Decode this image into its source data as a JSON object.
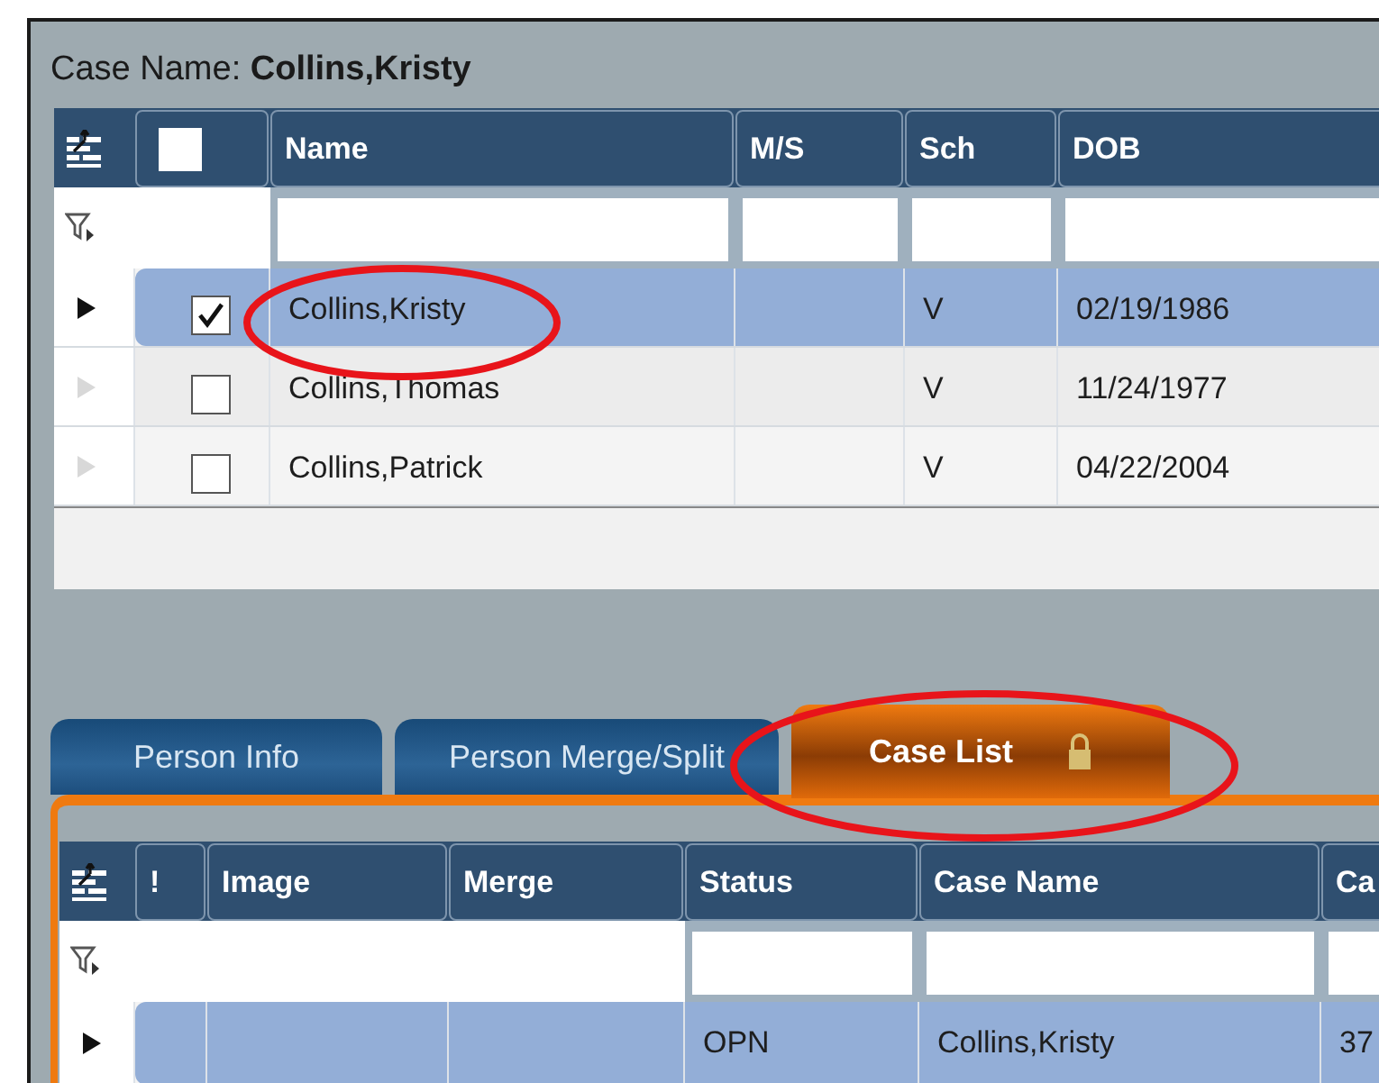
{
  "case_name": {
    "label": "Case Name:",
    "value": "Collins,Kristy"
  },
  "top_grid": {
    "select_all": {
      "checked": false
    },
    "columns": [
      "Name",
      "M/S",
      "Sch",
      "DOB"
    ],
    "rows": [
      {
        "name": "Collins,Kristy",
        "ms": "",
        "sch": "V",
        "dob": "02/19/1986",
        "checked": true,
        "selected": true
      },
      {
        "name": "Collins,Thomas",
        "ms": "",
        "sch": "V",
        "dob": "11/24/1977",
        "checked": false,
        "selected": false
      },
      {
        "name": "Collins,Patrick",
        "ms": "",
        "sch": "V",
        "dob": "04/22/2004",
        "checked": false,
        "selected": false
      }
    ]
  },
  "tabs": [
    {
      "label": "Person Info",
      "selected": false,
      "locked": false
    },
    {
      "label": "Person Merge/Split",
      "selected": false,
      "locked": false
    },
    {
      "label": "Case List",
      "selected": true,
      "locked": true
    }
  ],
  "case_grid": {
    "columns": [
      "!",
      "Image",
      "Merge",
      "Status",
      "Case Name",
      "Ca"
    ],
    "rows": [
      {
        "cells": [
          "",
          "",
          "",
          "OPN",
          "Collins,Kristy",
          "37"
        ],
        "selected": true
      }
    ]
  }
}
